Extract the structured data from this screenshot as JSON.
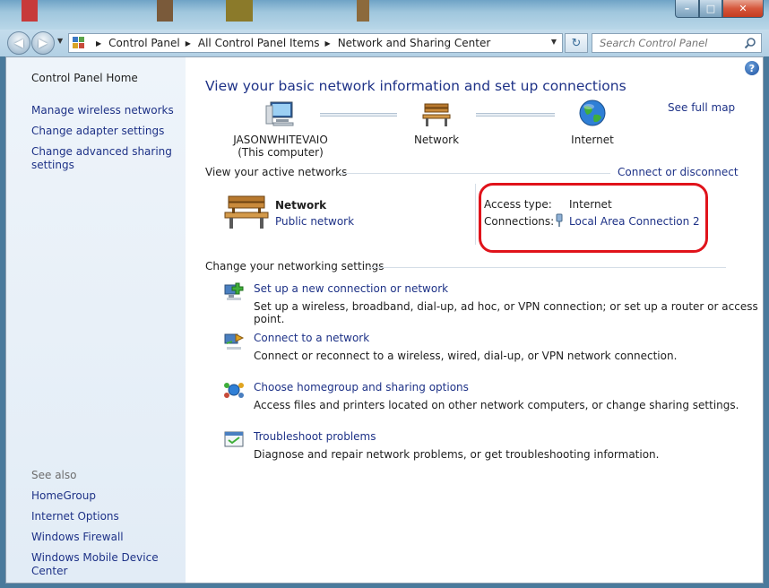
{
  "address": {
    "segments": [
      "Control Panel",
      "All Control Panel Items",
      "Network and Sharing Center"
    ],
    "search_placeholder": "Search Control Panel"
  },
  "sidebar": {
    "home": "Control Panel Home",
    "items": [
      "Manage wireless networks",
      "Change adapter settings",
      "Change advanced sharing",
      "settings"
    ],
    "see_also_heading": "See also",
    "see_also": [
      "HomeGroup",
      "Internet Options",
      "Windows Firewall",
      "Windows Mobile Device Center"
    ]
  },
  "main": {
    "title": "View your basic network information and set up connections",
    "see_full_map": "See full map",
    "map": {
      "computer_name": "JASONWHITEVAIO",
      "computer_sub": "(This computer)",
      "network": "Network",
      "internet": "Internet"
    },
    "active_networks": {
      "heading": "View your active networks",
      "connect_link": "Connect or disconnect",
      "network_name": "Network",
      "network_type": "Public network",
      "access_type_label": "Access type:",
      "access_type_value": "Internet",
      "connections_label": "Connections:",
      "connections_value": "Local Area Connection 2"
    },
    "settings": {
      "heading": "Change your networking settings",
      "tasks": [
        {
          "title": "Set up a new connection or network",
          "desc": "Set up a wireless, broadband, dial-up, ad hoc, or VPN connection; or set up a router or access point."
        },
        {
          "title": "Connect to a network",
          "desc": "Connect or reconnect to a wireless, wired, dial-up, or VPN network connection."
        },
        {
          "title": "Choose homegroup and sharing options",
          "desc": "Access files and printers located on other network computers, or change sharing settings."
        },
        {
          "title": "Troubleshoot problems",
          "desc": "Diagnose and repair network problems, or get troubleshooting information."
        }
      ]
    }
  },
  "colors": {
    "link": "#1e3287",
    "highlight": "#e0131b",
    "sidebar_bg": "#e7eff7"
  }
}
